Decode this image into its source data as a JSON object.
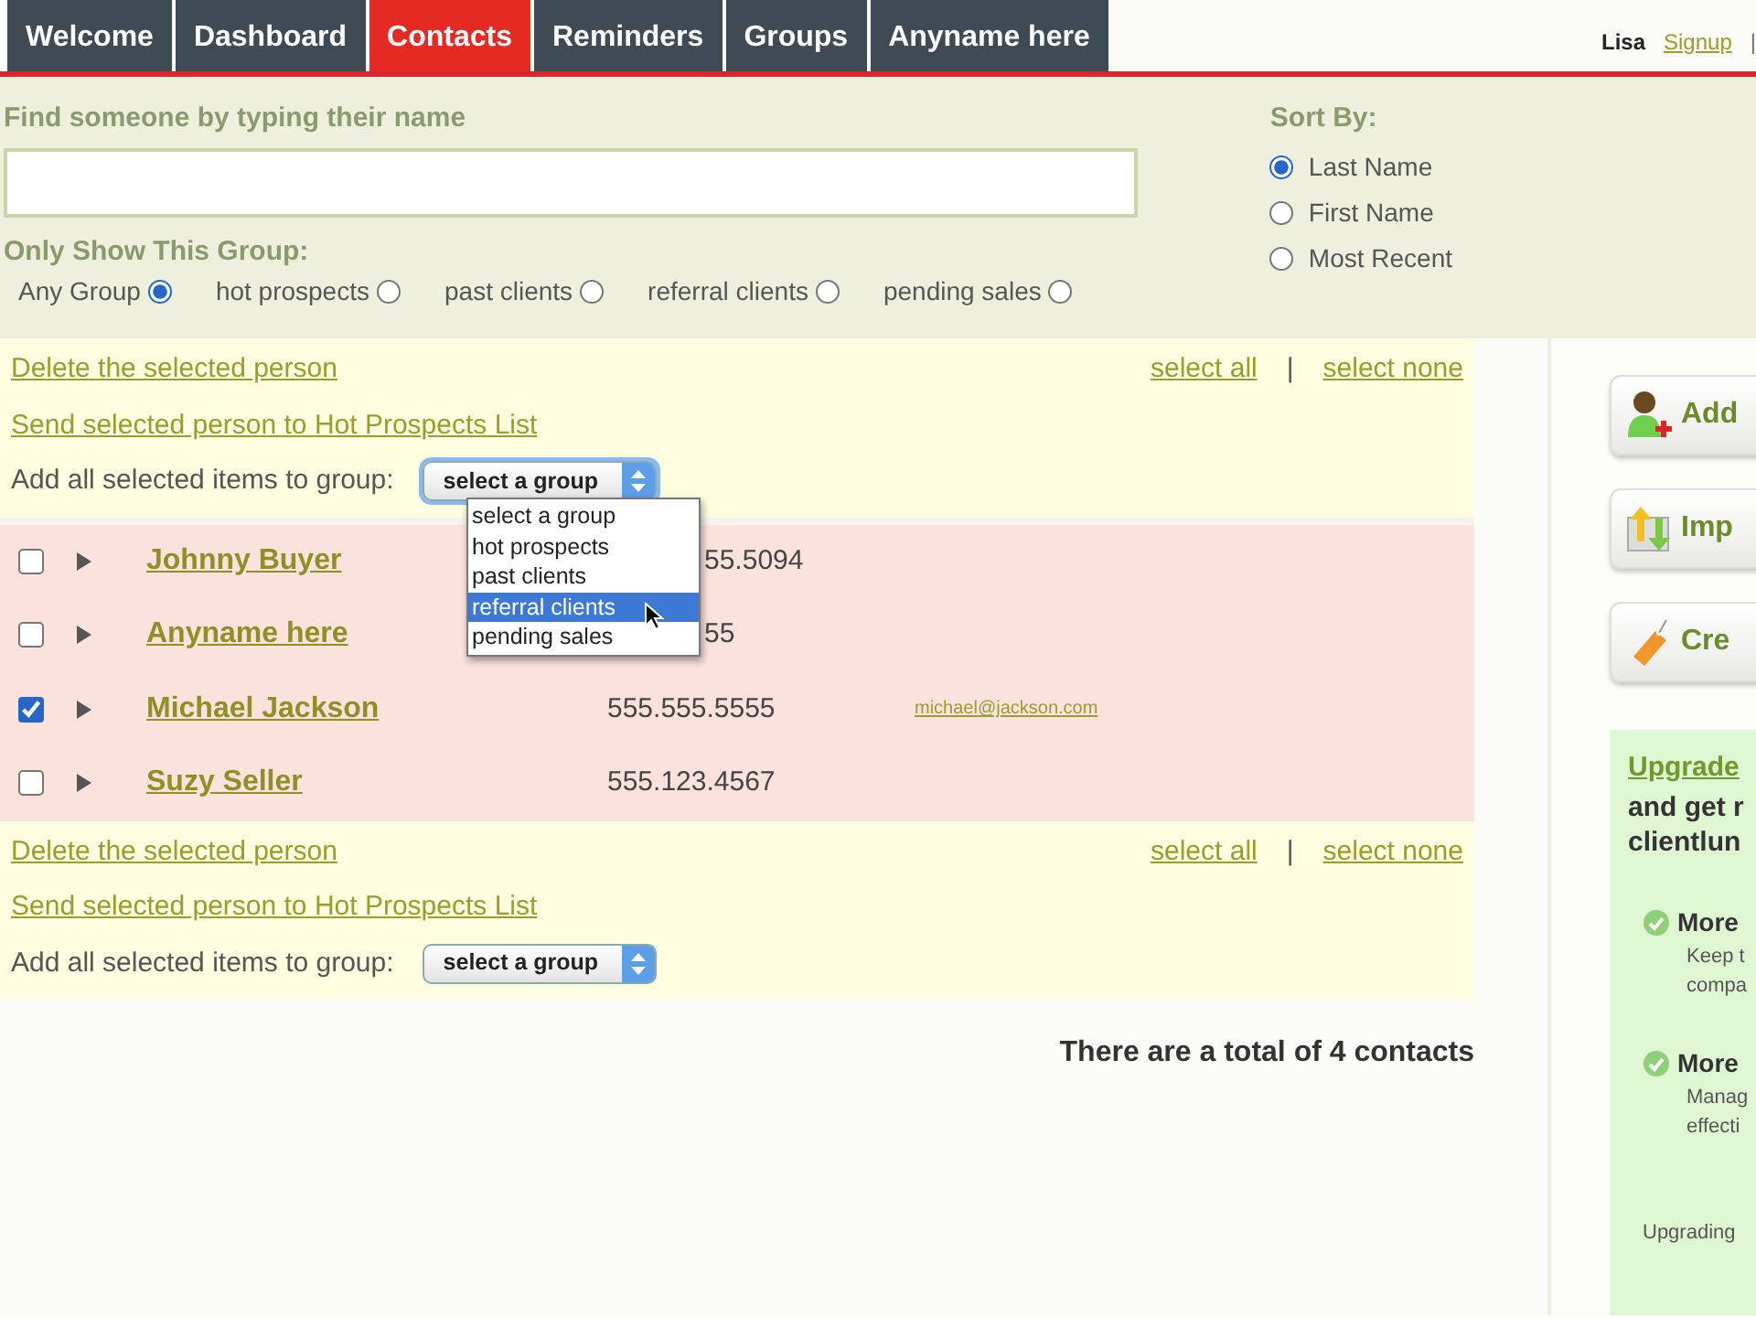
{
  "tabs": [
    {
      "label": "Welcome",
      "selected": false
    },
    {
      "label": "Dashboard",
      "selected": false
    },
    {
      "label": "Contacts",
      "selected": true
    },
    {
      "label": "Reminders",
      "selected": false
    },
    {
      "label": "Groups",
      "selected": false
    },
    {
      "label": "Anyname here",
      "selected": false
    }
  ],
  "user": {
    "name": "Lisa",
    "link": "Signup",
    "separator": "|"
  },
  "search": {
    "label": "Find someone by typing their name"
  },
  "group_filter": {
    "label": "Only Show This Group:",
    "options": [
      {
        "label": "Any Group",
        "selected": true
      },
      {
        "label": "hot prospects",
        "selected": false
      },
      {
        "label": "past clients",
        "selected": false
      },
      {
        "label": "referral clients",
        "selected": false
      },
      {
        "label": "pending sales",
        "selected": false
      }
    ]
  },
  "sort": {
    "label": "Sort By:",
    "options": [
      {
        "label": "Last Name",
        "selected": true
      },
      {
        "label": "First Name",
        "selected": false
      },
      {
        "label": "Most Recent",
        "selected": false
      }
    ]
  },
  "action_panels": [
    {
      "delete": "Delete the selected person",
      "send": "Send selected person to Hot Prospects List",
      "add_label": "Add all selected items to group:",
      "select_value": "select a group",
      "select_all": "select all",
      "separator": "|",
      "select_none": "select none",
      "menu_open": true,
      "menu": [
        {
          "label": "select a group",
          "selected": false
        },
        {
          "label": "hot prospects",
          "selected": false
        },
        {
          "label": "past clients",
          "selected": false
        },
        {
          "label": "referral clients",
          "selected": true
        },
        {
          "label": "pending sales",
          "selected": false
        }
      ]
    },
    {
      "delete": "Delete the selected person",
      "send": "Send selected person to Hot Prospects List",
      "add_label": "Add all selected items to group:",
      "select_value": "select a group",
      "select_all": "select all",
      "separator": "|",
      "select_none": "select none",
      "menu_open": false
    }
  ],
  "contacts": [
    {
      "name": "Johnny Buyer",
      "phone": "55.5094",
      "checked": false
    },
    {
      "name": "Anyname here",
      "phone": "55",
      "checked": false
    },
    {
      "name": "Michael Jackson",
      "phone": "555.555.5555",
      "email": "michael@jackson.com",
      "checked": true
    },
    {
      "name": "Suzy Seller",
      "phone": "555.123.4567",
      "checked": false
    }
  ],
  "total": "There are a total of 4 contacts",
  "sidebar": {
    "buttons": [
      {
        "label": "Add",
        "kind": "person"
      },
      {
        "label": "Imp",
        "kind": "import"
      },
      {
        "label": "Cre",
        "kind": "tag"
      }
    ],
    "upgrade": {
      "link": "Upgrade",
      "lines": [
        "and get r",
        "clientlun"
      ],
      "features": [
        {
          "title": "More",
          "lines": [
            "Keep t",
            "compa"
          ]
        },
        {
          "title": "More",
          "lines": [
            "Manag",
            "effecti"
          ]
        }
      ],
      "footer": "Upgrading"
    }
  }
}
